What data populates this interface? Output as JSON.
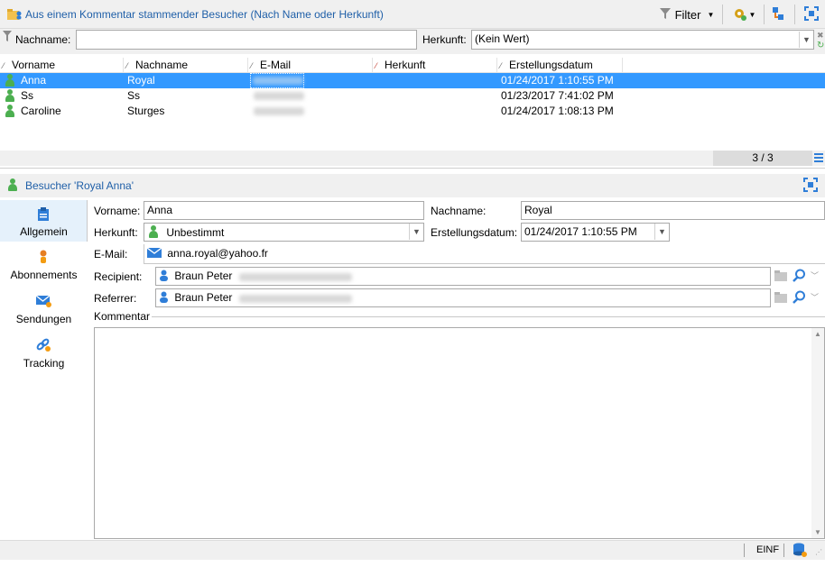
{
  "window": {
    "title": "Aus einem Kommentar stammender Besucher (Nach Name oder Herkunft)",
    "filter_label": "Filter"
  },
  "filter": {
    "nachname_label": "Nachname:",
    "nachname_value": "",
    "herkunft_label": "Herkunft:",
    "herkunft_value": "(Kein Wert)"
  },
  "grid": {
    "columns": [
      "Vorname",
      "Nachname",
      "E-Mail",
      "Herkunft",
      "Erstellungsdatum"
    ],
    "rows": [
      {
        "vorname": "Anna",
        "nachname": "Royal",
        "email": "",
        "herkunft": "",
        "datum": "01/24/2017 1:10:55 PM",
        "selected": true
      },
      {
        "vorname": "Ss",
        "nachname": "Ss",
        "email": "",
        "herkunft": "",
        "datum": "01/23/2017 7:41:02 PM",
        "selected": false
      },
      {
        "vorname": "Caroline",
        "nachname": "Sturges",
        "email": "",
        "herkunft": "",
        "datum": "01/24/2017 1:08:13 PM",
        "selected": false
      }
    ],
    "count": "3 / 3"
  },
  "detail": {
    "title": "Besucher 'Royal Anna'",
    "nav": [
      {
        "label": "Allgemein",
        "icon": "clipboard-icon"
      },
      {
        "label": "Abonnements",
        "icon": "person-pin-icon"
      },
      {
        "label": "Sendungen",
        "icon": "envelope-icon"
      },
      {
        "label": "Tracking",
        "icon": "link-icon"
      }
    ],
    "vorname_label": "Vorname:",
    "vorname_value": "Anna",
    "nachname_label": "Nachname:",
    "nachname_value": "Royal",
    "herkunft_label": "Herkunft:",
    "herkunft_value": "Unbestimmt",
    "erstellungsdatum_label": "Erstellungsdatum:",
    "erstellungsdatum_value": "01/24/2017 1:10:55 PM",
    "email_label": "E-Mail:",
    "email_value": "anna.royal@yahoo.fr",
    "recipient_label": "Recipient:",
    "recipient_value": "Braun Peter",
    "referrer_label": "Referrer:",
    "referrer_value": "Braun Peter",
    "kommentar_label": "Kommentar",
    "kommentar_value": ""
  },
  "status": {
    "mode": "EINF"
  },
  "colors": {
    "accent": "#3399ff",
    "title_blue": "#1f5fa8",
    "person_green": "#4caf50",
    "toolbar_bg": "#f0f0f0"
  }
}
